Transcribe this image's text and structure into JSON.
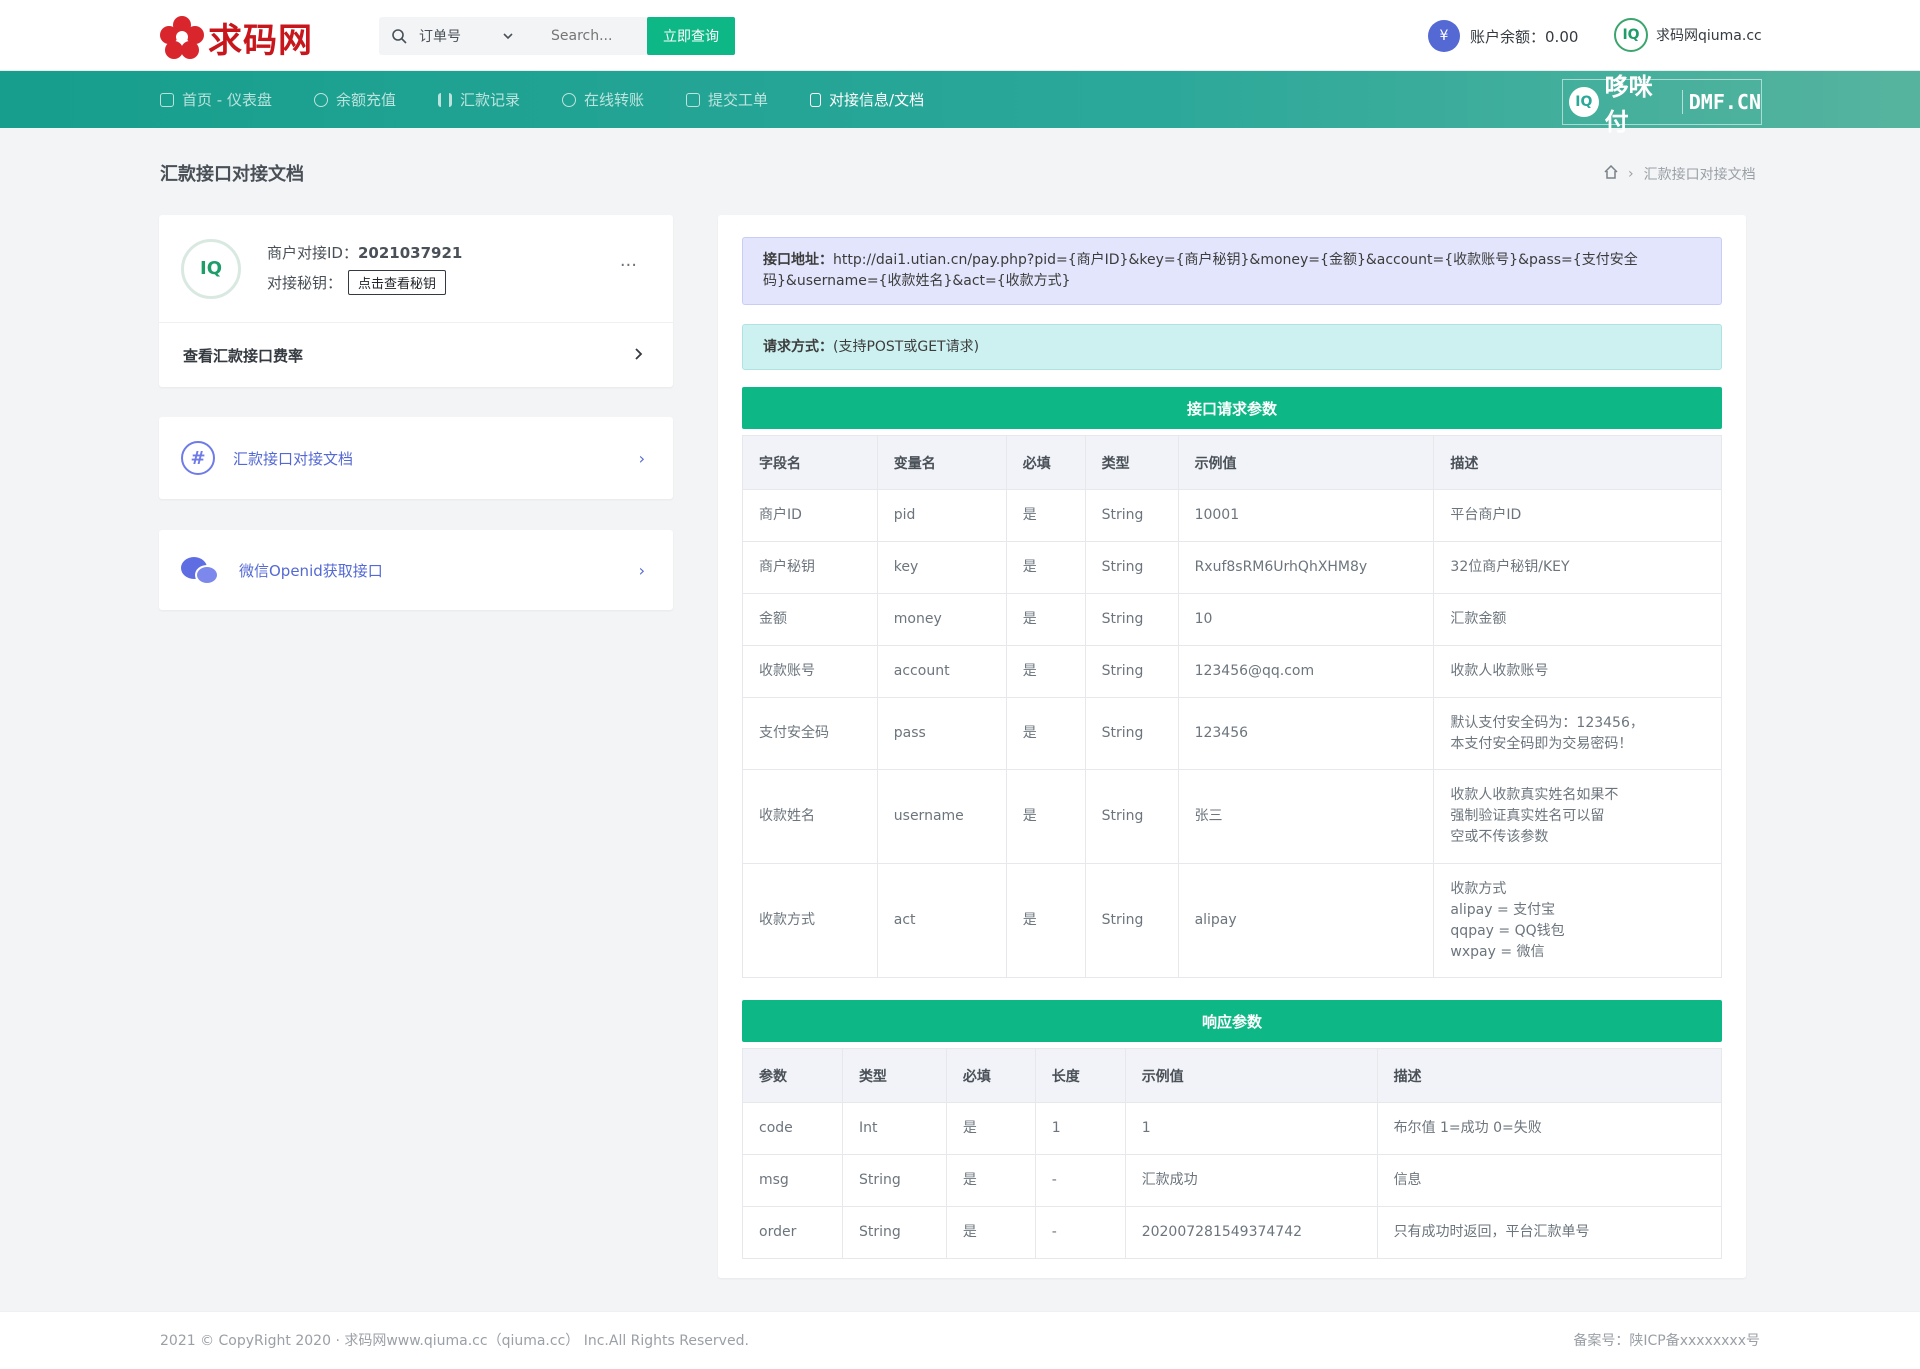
{
  "brand": {
    "name": "求码网"
  },
  "search": {
    "type_label": "订单号",
    "placeholder": "Search...",
    "button": "立即查询"
  },
  "account": {
    "balance_label": "账户余额：",
    "balance_value": "0.00",
    "yen": "¥",
    "username": "求码网qiuma.cc"
  },
  "nav": {
    "items": [
      {
        "label": "首页 - 仪表盘",
        "icon": "home-icon"
      },
      {
        "label": "余额充值",
        "icon": "coin-icon"
      },
      {
        "label": "汇款记录",
        "icon": "bar-chart-icon"
      },
      {
        "label": "在线转账",
        "icon": "transfer-icon"
      },
      {
        "label": "提交工单",
        "icon": "edit-icon"
      },
      {
        "label": "对接信息/文档",
        "icon": "document-icon"
      }
    ],
    "active_index": 5,
    "partner_logo": {
      "text": "哆咪付",
      "domain": "DMF.CN"
    }
  },
  "page": {
    "title": "汇款接口对接文档",
    "breadcrumb_current": "汇款接口对接文档"
  },
  "merchant": {
    "id_label": "商户对接ID：",
    "id_value": "2021037921",
    "key_label": "对接秘钥：",
    "key_button": "点击查看秘钥",
    "more": "···",
    "rate_link": "查看汇款接口费率"
  },
  "side_links": [
    {
      "label": "汇款接口对接文档",
      "icon": "hash-icon"
    },
    {
      "label": "微信Openid获取接口",
      "icon": "wechat-icon"
    }
  ],
  "api": {
    "url_label": "接口地址：",
    "url": "http://dai1.utian.cn/pay.php?pid={商户ID}&key={商户秘钥}&money={金额}&account={收款账号}&pass={支付安全码}&username={收款姓名}&act={收款方式}",
    "method_label": "请求方式：",
    "method": "(支持POST或GET请求)",
    "request_title": "接口请求参数",
    "request_headers": [
      "字段名",
      "变量名",
      "必填",
      "类型",
      "示例值",
      "描述"
    ],
    "request_rows": [
      [
        "商户ID",
        "pid",
        "是",
        "String",
        "10001",
        "平台商户ID"
      ],
      [
        "商户秘钥",
        "key",
        "是",
        "String",
        "Rxuf8sRM6UrhQhXHM8y",
        "32位商户秘钥/KEY"
      ],
      [
        "金额",
        "money",
        "是",
        "String",
        "10",
        "汇款金额"
      ],
      [
        "收款账号",
        "account",
        "是",
        "String",
        "123456@qq.com",
        "收款人收款账号"
      ],
      [
        "支付安全码",
        "pass",
        "是",
        "String",
        "123456",
        "默认支付安全码为：123456，\n本支付安全码即为交易密码！"
      ],
      [
        "收款姓名",
        "username",
        "是",
        "String",
        "张三",
        "收款人收款真实姓名如果不\n强制验证真实姓名可以留\n空或不传该参数"
      ],
      [
        "收款方式",
        "act",
        "是",
        "String",
        "alipay",
        "收款方式\nalipay = 支付宝\nqqpay = QQ钱包\nwxpay = 微信"
      ]
    ],
    "response_title": "响应参数",
    "response_headers": [
      "参数",
      "类型",
      "必填",
      "长度",
      "示例值",
      "描述"
    ],
    "response_rows": [
      [
        "code",
        "Int",
        "是",
        "1",
        "1",
        "布尔值 1=成功 0=失败"
      ],
      [
        "msg",
        "String",
        "是",
        "-",
        "汇款成功",
        "信息"
      ],
      [
        "order",
        "String",
        "是",
        "-",
        "202007281549374742",
        "只有成功时返回，平台汇款单号"
      ]
    ]
  },
  "footer": {
    "copyright": "2021 © CopyRight 2020 · 求码网www.qiuma.cc（qiuma.cc） Inc.All Rights Reserved.",
    "icp": "备案号：陕ICP备xxxxxxxx号"
  },
  "colors": {
    "accent_green": "#0eb886",
    "nav_teal": "#179e8c",
    "link_blue": "#5469d4"
  }
}
